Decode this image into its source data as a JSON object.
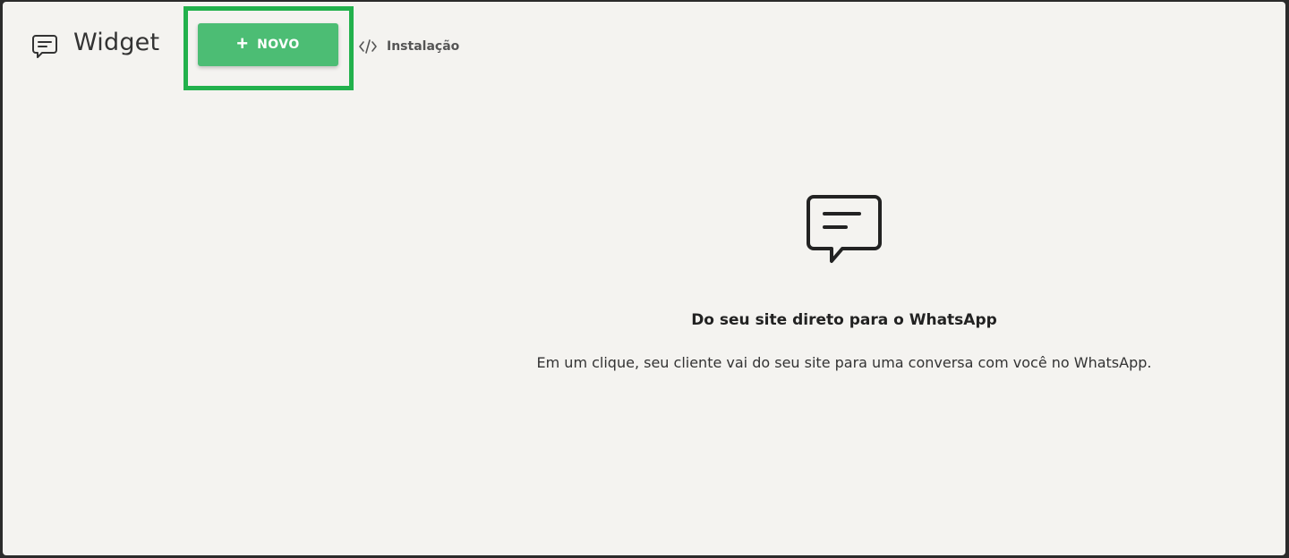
{
  "header": {
    "title": "Widget",
    "new_button_label": "NOVO",
    "install_label": "Instalação"
  },
  "empty_state": {
    "heading": "Do seu site direto para o WhatsApp",
    "description": "Em um clique, seu cliente vai do seu site para uma conversa com você no WhatsApp."
  },
  "icons": {
    "title": "chat-icon",
    "new": "plus-icon",
    "install": "code-icon",
    "empty": "chat-icon"
  },
  "colors": {
    "accent": "#4cbd74",
    "highlight": "#22b14c",
    "background": "#f4f3f0",
    "text": "#333333"
  }
}
